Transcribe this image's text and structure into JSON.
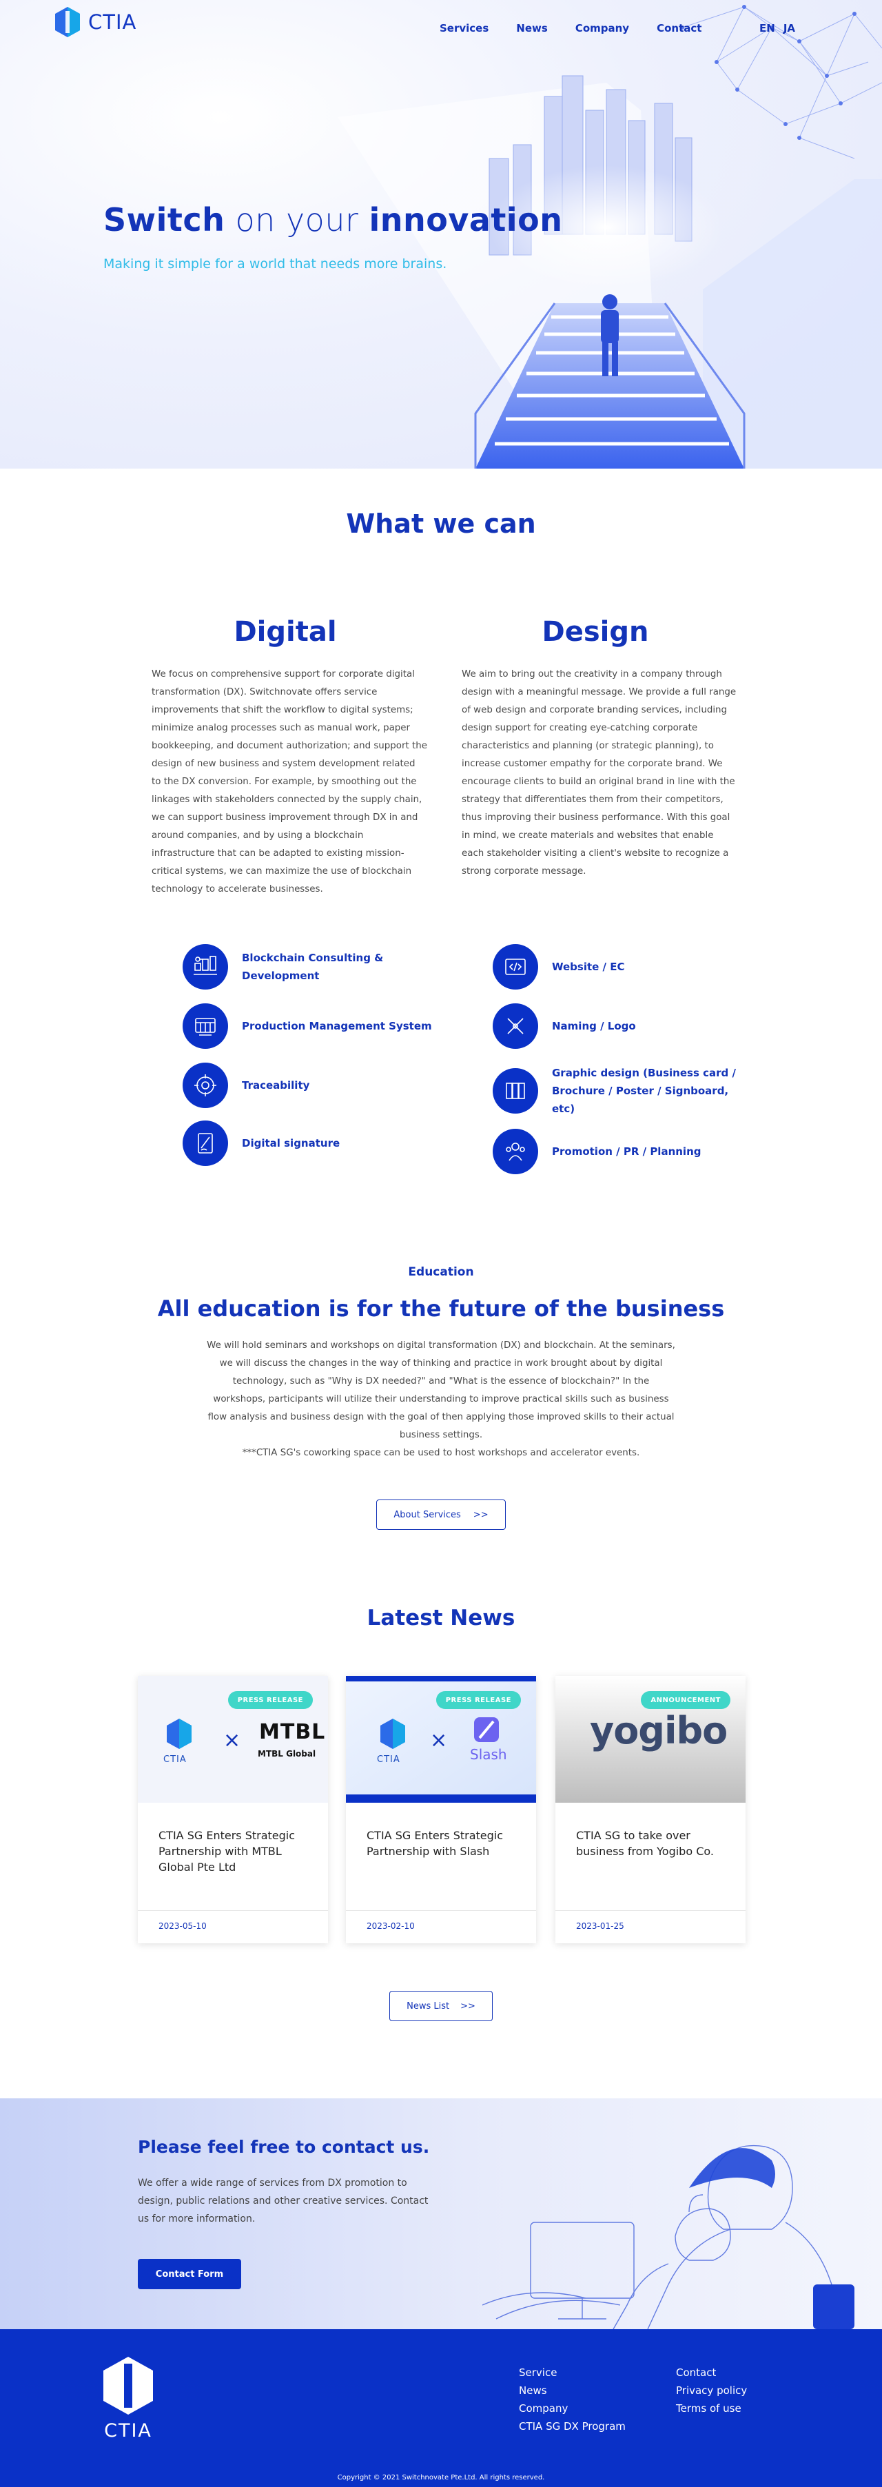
{
  "header": {
    "logo_text": "CTIA",
    "nav": [
      "Services",
      "News",
      "Company",
      "Contact"
    ],
    "lang": [
      "EN",
      "JA"
    ]
  },
  "hero": {
    "title_part1": "Switch",
    "title_part2": " on your ",
    "title_part3": "innovation",
    "subtitle": "Making it simple for a world that needs more brains."
  },
  "what_we_can": {
    "title": "What we can",
    "digital": {
      "title": "Digital",
      "text": "We focus on comprehensive support for corporate digital transformation (DX). Switchnovate offers service improvements that shift the workflow to digital systems; minimize analog processes such as manual work, paper bookkeeping, and document authorization; and support the design of new business and system development related to the DX conversion. For example, by smoothing out the linkages with stakeholders connected by the supply chain, we can support business improvement through DX in and around companies, and by using a blockchain infrastructure that can be adapted to existing mission-critical systems, we can maximize the use of blockchain technology to accelerate businesses.",
      "services": [
        {
          "label": "Blockchain Consulting & Development",
          "icon": "blockchain-icon"
        },
        {
          "label": "Production Management System",
          "icon": "production-icon"
        },
        {
          "label": "Traceability",
          "icon": "traceability-icon"
        },
        {
          "label": "Digital signature",
          "icon": "signature-icon"
        }
      ]
    },
    "design": {
      "title": "Design",
      "text": "We aim to bring out the creativity in a company through design with a meaningful message. We provide a full range of web design and corporate branding services, including design support for creating eye-catching corporate characteristics and planning (or strategic planning), to increase customer empathy for the corporate brand. We encourage clients to build an original brand in line with the strategy that differentiates them from their competitors, thus improving their business performance. With this goal in mind, we create materials and websites that enable each stakeholder visiting a client's website to recognize a strong corporate message.",
      "services": [
        {
          "label": "Website / EC",
          "icon": "code-icon"
        },
        {
          "label": "Naming / Logo",
          "icon": "pen-icon"
        },
        {
          "label": "Graphic design (Business card / Brochure / Poster / Signboard, etc)",
          "icon": "brochure-icon"
        },
        {
          "label": "Promotion / PR / Planning",
          "icon": "promotion-icon"
        }
      ]
    }
  },
  "education": {
    "kicker": "Education",
    "title": "All education is for the future of the business",
    "text": "We will hold seminars and workshops on digital transformation (DX) and blockchain. At the seminars, we will discuss the changes in the way of thinking and practice in work brought about by digital technology, such as \"Why is DX needed?\" and \"What is the essence of blockchain?\" In the workshops, participants will utilize their understanding to improve practical skills such as business flow analysis and business design with the goal of then applying those improved skills to their actual business settings.",
    "note": "***CTIA SG's coworking space can be used to host workshops and accelerator events.",
    "button": "About Services",
    "button_arrow": ">>"
  },
  "news": {
    "title": "Latest News",
    "items": [
      {
        "badge": "PRESS RELEASE",
        "title": "CTIA SG Enters Strategic Partnership with MTBL Global Pte Ltd",
        "date": "2023-05-10",
        "partner": "MTBL",
        "partner_sub": "MTBL Global",
        "logo_caption": "CTIA"
      },
      {
        "badge": "PRESS RELEASE",
        "title": "CTIA SG Enters Strategic Partnership with Slash",
        "date": "2023-02-10",
        "partner": "Slash",
        "logo_caption": "CTIA"
      },
      {
        "badge": "ANNOUNCEMENT",
        "title": "CTIA SG to take over business from Yogibo Co.",
        "date": "2023-01-25",
        "partner": "yogibo"
      }
    ],
    "cross": "×",
    "button": "News List",
    "button_arrow": ">>"
  },
  "contact": {
    "title": "Please feel free to contact us.",
    "text": "We offer a wide range of services from DX promotion to design, public relations and other creative services. Contact us for more information.",
    "button": "Contact Form"
  },
  "footer": {
    "logo_text": "CTIA",
    "col1": [
      "Service",
      "News",
      "Company",
      "CTIA SG DX Program"
    ],
    "col2": [
      "Contact",
      "Privacy policy",
      "Terms of use"
    ],
    "copyright": "Copyright © 2021 Switchnovate Pte.Ltd. All rights reserved."
  },
  "colors": {
    "brand_blue": "#0a31c7",
    "heading_blue": "#1334b8",
    "accent_cyan": "#31bce8",
    "badge_teal": "#3fd6c8"
  }
}
